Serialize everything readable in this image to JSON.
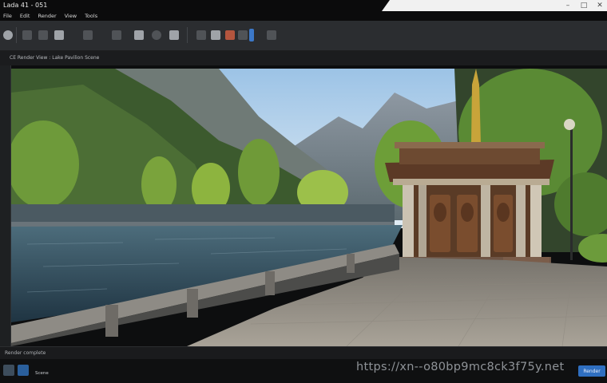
{
  "window": {
    "title": "Lada 41 - 051",
    "controls": {
      "minimize": "–",
      "maximize": "□",
      "close": "✕"
    }
  },
  "menu": [
    "File",
    "Edit",
    "Render",
    "View",
    "Tools"
  ],
  "toolbar": {
    "buttons": [
      "power-icon",
      "move-icon",
      "rotate-icon",
      "scale-icon",
      "snap-icon",
      "camera-icon",
      "light-icon",
      "material-icon",
      "render-icon",
      "export-icon",
      "settings-icon"
    ]
  },
  "document": {
    "title": "CE Render View : Lake Pavilion Scene"
  },
  "status": {
    "text": "Render complete"
  },
  "taskbar": {
    "label": "Scene",
    "action": "Render"
  },
  "watermark": "https://xn--o80bp9mc8ck3f75y.net",
  "colors": {
    "sky": "#bcd6ec",
    "water": "#2c4a5c",
    "accent": "#2f6fc0"
  }
}
